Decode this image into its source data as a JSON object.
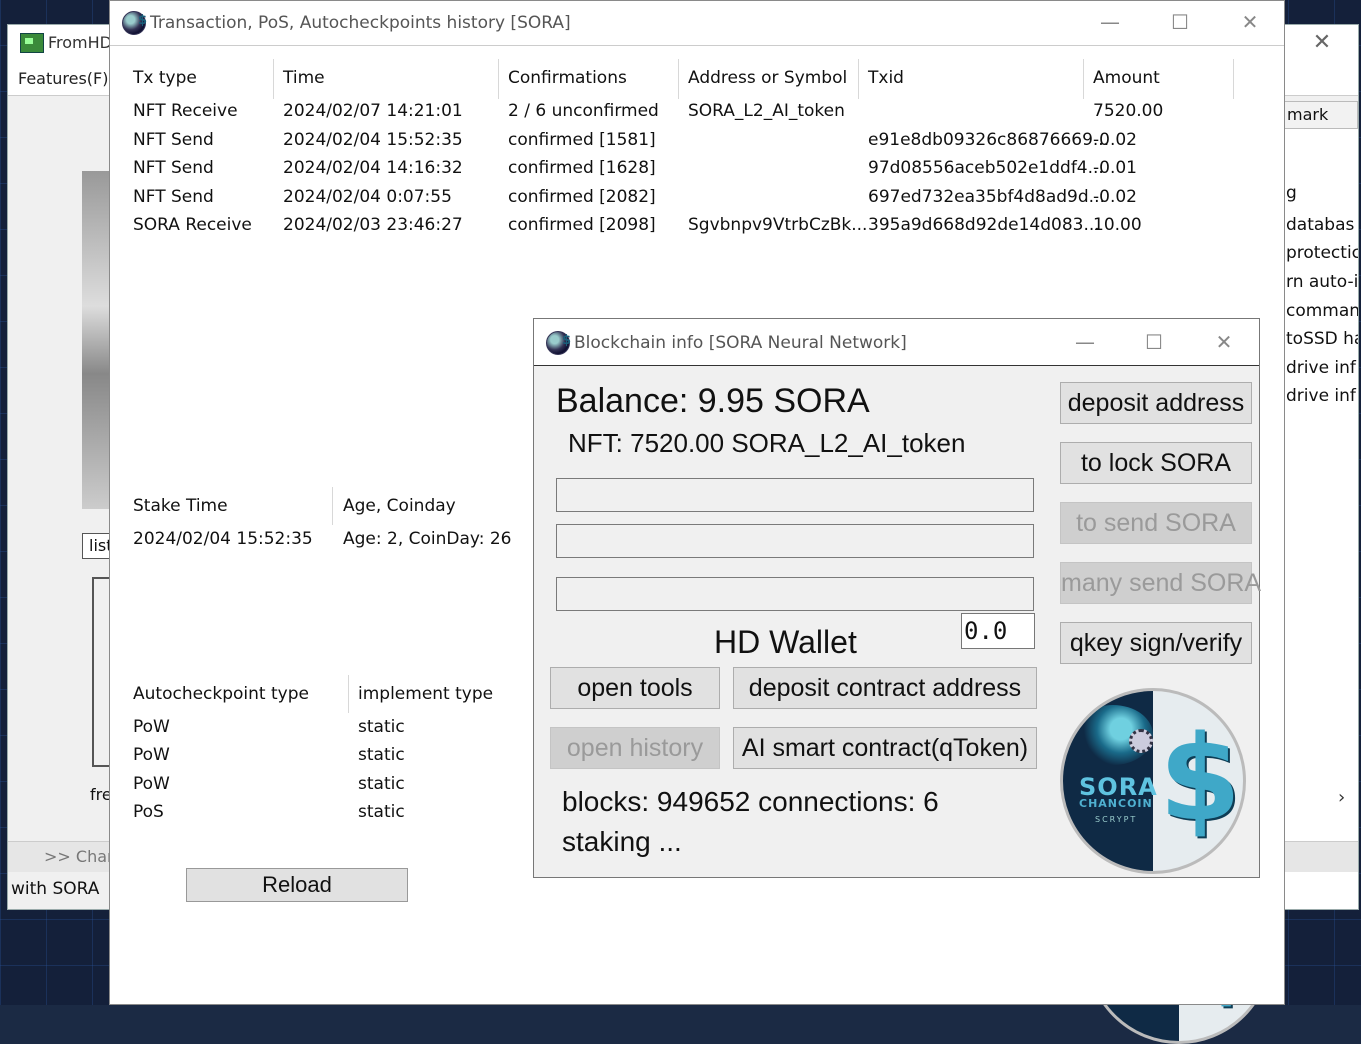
{
  "back_window": {
    "title": "FromHDD",
    "menu_label": "Features(F)",
    "list_label": "list",
    "fre_label": "fre",
    "chain_label": ">> Chan",
    "with_sora_label": "with SORA",
    "bookmark_label": "mark",
    "right_lines": [
      "g",
      "databas",
      "protectic",
      "rn auto-i",
      "comman",
      "toSSD ha",
      "drive inf",
      "drive inf"
    ]
  },
  "tx_window": {
    "title": "Transaction, PoS, Autocheckpoints history [SORA]",
    "columns": [
      "Tx type",
      "Time",
      "Confirmations",
      "Address or Symbol",
      "Txid",
      "Amount"
    ],
    "rows": [
      {
        "type": "NFT Receive",
        "time": "2024/02/07 14:21:01",
        "conf": "2 / 6 unconfirmed",
        "addr": "SORA_L2_AI_token",
        "txid": "",
        "amount": "7520.00"
      },
      {
        "type": "NFT Send",
        "time": "2024/02/04 15:52:35",
        "conf": "confirmed [1581]",
        "addr": "",
        "txid": "e91e8db09326c86876669...",
        "amount": "-0.02"
      },
      {
        "type": "NFT Send",
        "time": "2024/02/04 14:16:32",
        "conf": "confirmed [1628]",
        "addr": "",
        "txid": "97d08556aceb502e1ddf4...",
        "amount": "-0.01"
      },
      {
        "type": "NFT Send",
        "time": "2024/02/04 0:07:55",
        "conf": "confirmed [2082]",
        "addr": "",
        "txid": "697ed732ea35bf4d8ad9d...",
        "amount": "-0.02"
      },
      {
        "type": "SORA Receive",
        "time": "2024/02/03 23:46:27",
        "conf": "confirmed [2098]",
        "addr": "Sgvbnpv9VtrbCzBk...",
        "txid": "395a9d668d92de14d083...",
        "amount": "10.00"
      }
    ],
    "stake_columns": [
      "Stake Time",
      "Age, Coinday"
    ],
    "stake_rows": [
      {
        "time": "2024/02/04 15:52:35",
        "age": "Age: 2, CoinDay: 26"
      }
    ],
    "cp_columns": [
      "Autocheckpoint type",
      "implement type"
    ],
    "cp_rows": [
      {
        "type": "PoW",
        "impl": "static"
      },
      {
        "type": "PoW",
        "impl": "static"
      },
      {
        "type": "PoW",
        "impl": "static"
      },
      {
        "type": "PoS",
        "impl": "static"
      }
    ],
    "reload_label": "Reload"
  },
  "bc_window": {
    "title": "Blockchain info [SORA Neural Network]",
    "balance": "Balance: 9.95 SORA",
    "nft": "NFT: 7520.00 SORA_L2_AI_token",
    "small_field_value": "0.0",
    "hd_wallet": "HD Wallet",
    "buttons": {
      "deposit_address": "deposit address",
      "lock": "to lock SORA",
      "send": "to send SORA",
      "many_send": "many send SORA",
      "qkey": "qkey sign/verify",
      "open_tools": "open tools",
      "deposit_contract": "deposit contract address",
      "open_history": "open history",
      "ai_contract": "AI smart contract(qToken)"
    },
    "status_blocks": "blocks: 949652 connections: 6",
    "status_staking": "staking ...",
    "logo": {
      "line1": "SORA",
      "line2": "CHANCOIN",
      "line3": "SCRYPT",
      "symbol": "$"
    }
  },
  "colors": {
    "disabled_text": "#9a9a9a",
    "accent": "#3fa8c8"
  }
}
